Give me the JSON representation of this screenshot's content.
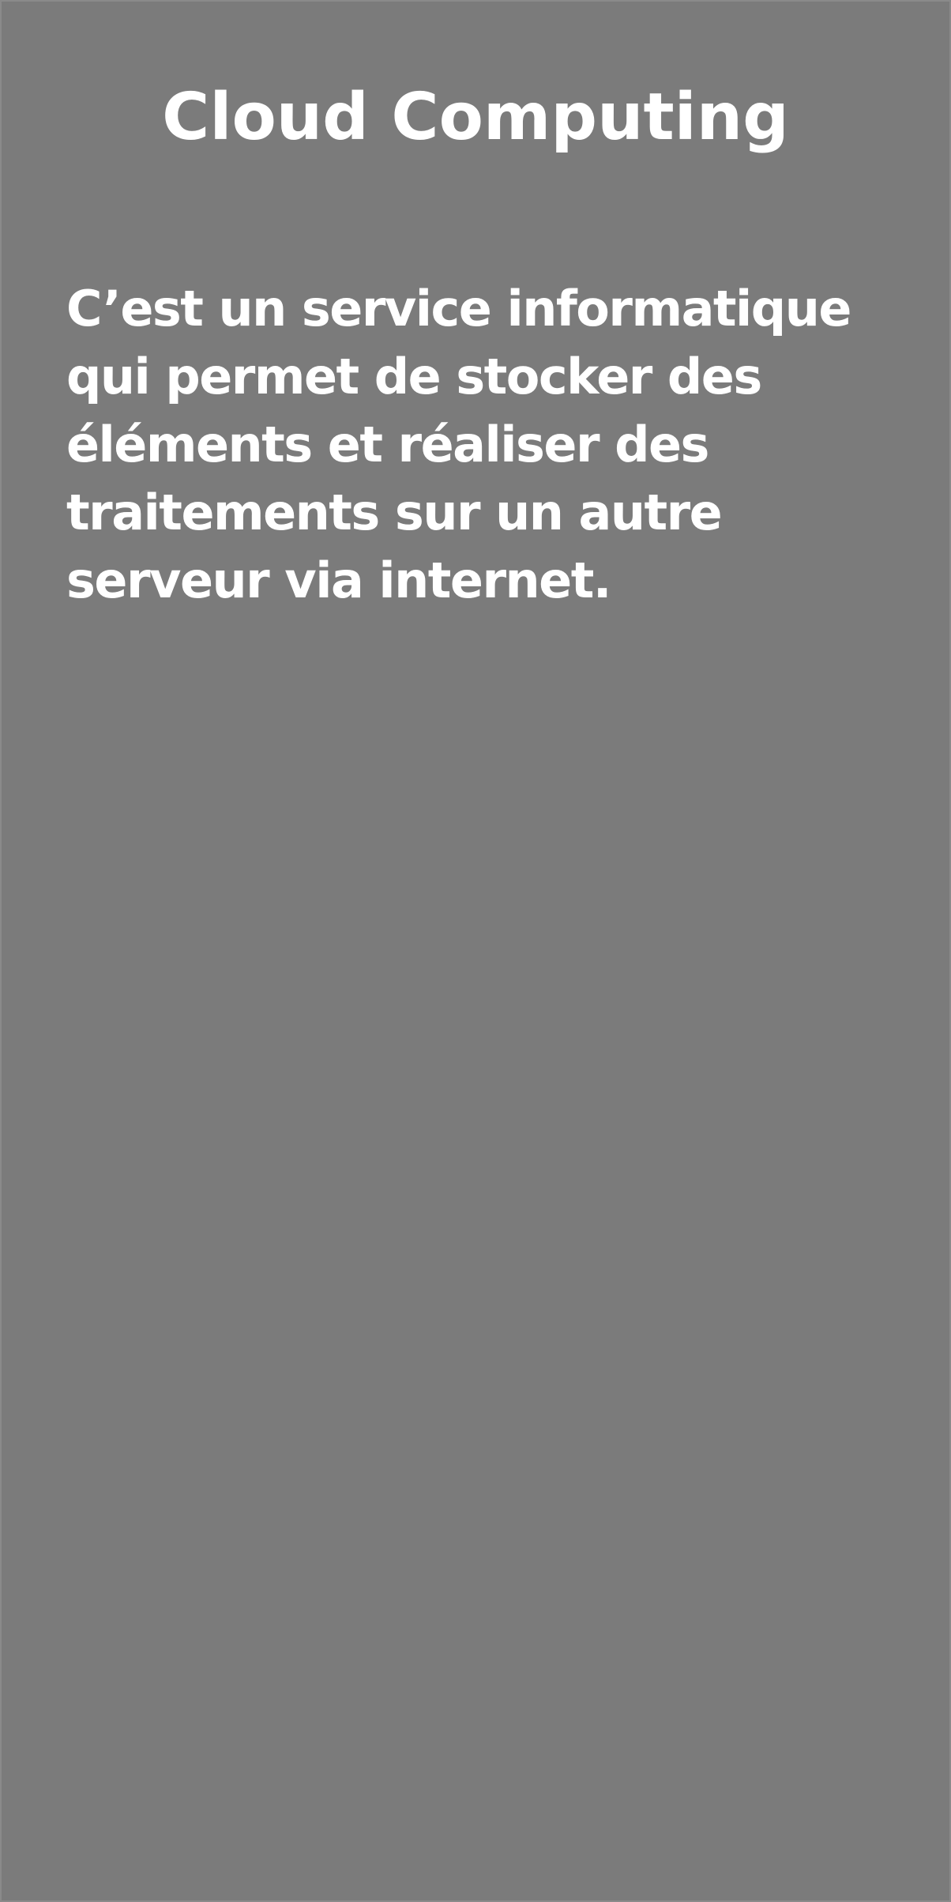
{
  "slide": {
    "background_color": "#7b7b7b",
    "text_color": "#ffffff",
    "title": "Cloud Computing",
    "definition_lines": [
      "C’est un service informatique",
      "qui permet de stocker des",
      "éléments et réaliser des",
      "traitements sur un autre",
      "serveur via internet."
    ]
  }
}
